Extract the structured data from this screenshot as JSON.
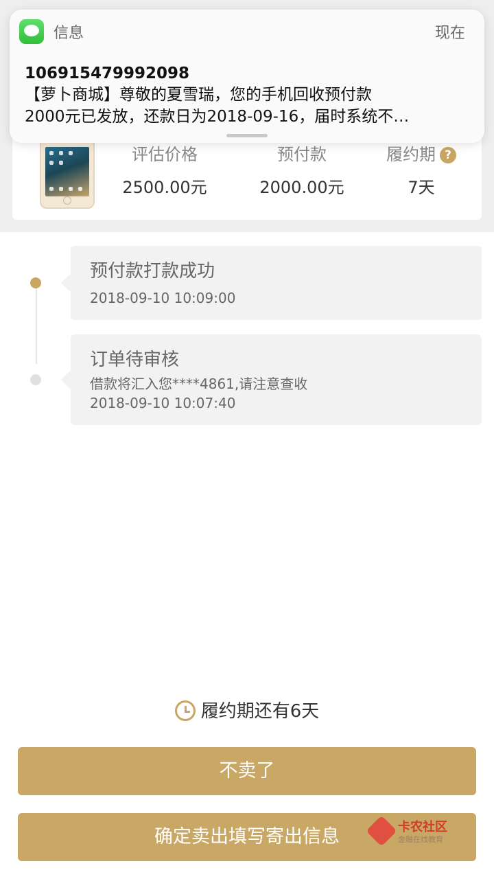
{
  "notification": {
    "app_name": "信息",
    "time": "现在",
    "sender": "106915479992098",
    "line1": "【萝卜商城】尊敬的夏雪瑞，您的手机回收预付款",
    "line2": "2000元已发放，还款日为2018-09-16，届时系统不…"
  },
  "product": {
    "image_icon": "iphone-image",
    "columns": [
      {
        "label": "评估价格",
        "value": "2500.00元"
      },
      {
        "label": "预付款",
        "value": "2000.00元"
      },
      {
        "label": "履约期",
        "value": "7天",
        "help_icon": "question-icon",
        "help_glyph": "?"
      }
    ]
  },
  "timeline": [
    {
      "title": "预付款打款成功",
      "lines": [
        "2018-09-10 10:09:00"
      ],
      "active": true,
      "dot_color": "#c8a661"
    },
    {
      "title": "订单待审核",
      "lines": [
        "借款将汇入您****4861,请注意查收",
        "2018-09-10 10:07:40"
      ],
      "active": false,
      "dot_color": "#e0e0e0"
    }
  ],
  "countdown": {
    "icon": "clock-icon",
    "text": "履约期还有6天"
  },
  "buttons": {
    "cancel_sell": "不卖了",
    "confirm_sell": "确定卖出填写寄出信息"
  },
  "watermark": {
    "title": "卡农社区",
    "subtitle": "金融在线教育"
  },
  "colors": {
    "accent": "#c9a865",
    "background_top": "#eeeeee",
    "card": "#f2f2f2"
  }
}
